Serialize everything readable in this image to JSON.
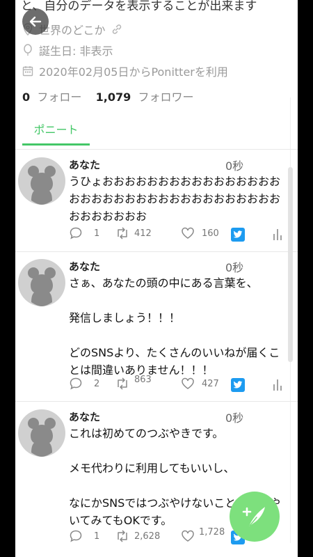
{
  "profile": {
    "bio_partial": "と、自分のデータを表示することが出来ます",
    "location": "世界のどこか",
    "birthday": "誕生日: 非表示",
    "joined": "2020年02月05日からPonitterを利用",
    "following_count": "0",
    "following_label": "フォロー",
    "followers_count": "1,079",
    "followers_label": "フォロワー"
  },
  "tabs": {
    "active": "ポニート"
  },
  "posts": [
    {
      "name": "あなた",
      "time": "0秒",
      "text": "うひょおおおおおおおおおおおおおおおおおおおおおおおおおおおおおおおおおおおおおおおおおお",
      "replies": "1",
      "retweets": "412",
      "likes": "160"
    },
    {
      "name": "あなた",
      "time": "0秒",
      "text": "さぁ、あなたの頭の中にある言葉を、\n\n発信しましょう！！！\n\nどのSNSより、たくさんのいいねが届くことは間違いありません！！！",
      "replies": "2",
      "retweets": "863",
      "likes": "427"
    },
    {
      "name": "あなた",
      "time": "0秒",
      "text": "これは初めてのつぶやきです。\n\nメモ代わりに利用してもいいし、\n\nなにかSNSではつぶやけないことをつぶやいてみてもOKです。",
      "replies": "1",
      "retweets": "2,628",
      "likes": "1,728"
    }
  ],
  "colors": {
    "accent": "#44c767",
    "fab": "#7de07d",
    "twitter": "#1d9bf0"
  }
}
